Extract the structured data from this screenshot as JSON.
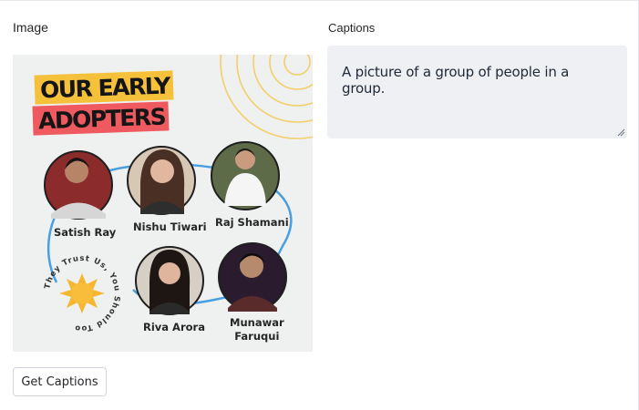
{
  "image_panel": {
    "label": "Image"
  },
  "poster": {
    "title_line_1": "OUR EARLY",
    "title_line_2": "ADOPTERS",
    "badge_text": "They Trust Us, You Should Too",
    "people": [
      {
        "name": "Satish Ray"
      },
      {
        "name": "Nishu Tiwari"
      },
      {
        "name": "Raj Shamani"
      },
      {
        "name": "Riva Arora"
      },
      {
        "name_line_1": "Munawar",
        "name_line_2": "Faruqui"
      }
    ]
  },
  "captions_panel": {
    "label": "Captions",
    "value": "A picture of a group of people in a group."
  },
  "actions": {
    "get_captions_label": "Get Captions"
  }
}
